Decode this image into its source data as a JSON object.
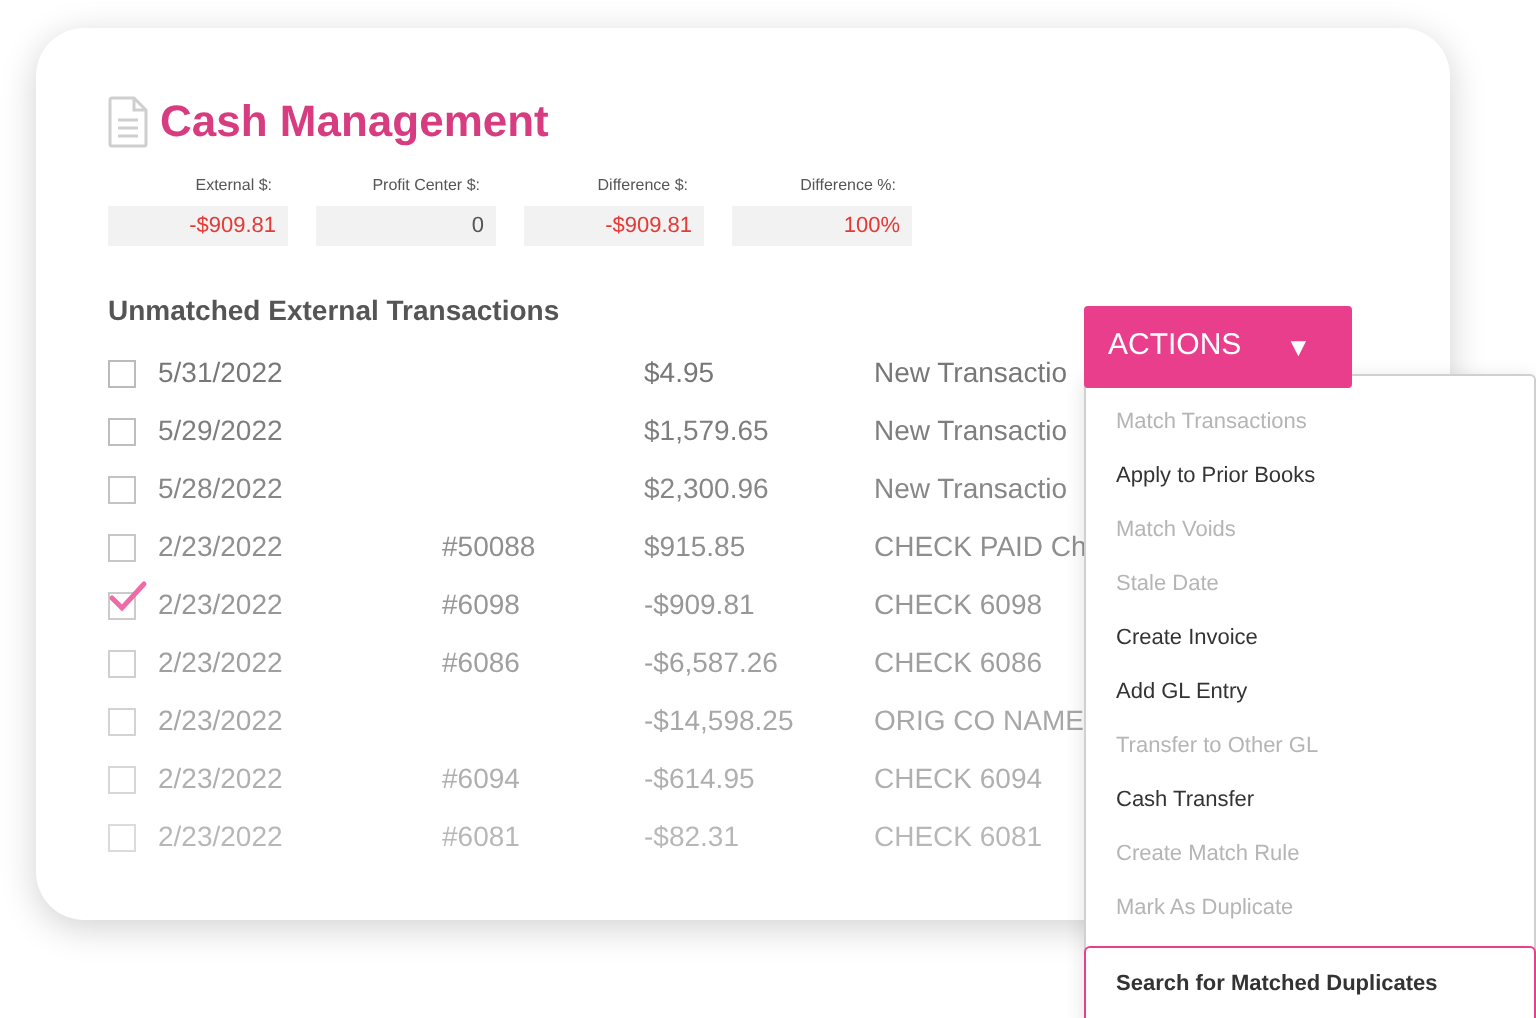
{
  "title": "Cash Management",
  "summary": [
    {
      "label": "External $:",
      "value": "-$909.81",
      "negative": true
    },
    {
      "label": "Profit Center $:",
      "value": "0",
      "negative": false
    },
    {
      "label": "Difference $:",
      "value": "-$909.81",
      "negative": true
    },
    {
      "label": "Difference %:",
      "value": "100%",
      "negative": true
    }
  ],
  "section_title": "Unmatched External Transactions",
  "transactions": [
    {
      "checked": false,
      "date": "5/31/2022",
      "amount": "$4.95",
      "description": "New Transactio"
    },
    {
      "checked": false,
      "date": "5/29/2022",
      "amount": "$1,579.65",
      "description": "New Transactio"
    },
    {
      "checked": false,
      "date": "5/28/2022",
      "amount": "$2,300.96",
      "description": "New Transactio"
    },
    {
      "checked": false,
      "date": "2/23/2022",
      "ref": "#50088",
      "amount": "$915.85",
      "description": "CHECK PAID Ch"
    },
    {
      "checked": true,
      "date": "2/23/2022",
      "ref": "#6098",
      "amount": "-$909.81",
      "description": "CHECK 6098"
    },
    {
      "checked": false,
      "date": "2/23/2022",
      "ref": "#6086",
      "amount": "-$6,587.26",
      "description": "CHECK 6086"
    },
    {
      "checked": false,
      "date": "2/23/2022",
      "amount": "-$14,598.25",
      "description": "ORIG CO NAME"
    },
    {
      "checked": false,
      "date": "2/23/2022",
      "ref": "#6094",
      "amount": "-$614.95",
      "description": "CHECK 6094"
    },
    {
      "checked": false,
      "date": "2/23/2022",
      "ref": "#6081",
      "amount": "-$82.31",
      "description": "CHECK 6081"
    }
  ],
  "actions": {
    "label": "ACTIONS",
    "caret": "▼",
    "expanded": true,
    "items": [
      {
        "label": "Match Transactions",
        "disabled": true,
        "selected": false
      },
      {
        "label": "Apply to Prior Books",
        "disabled": false,
        "selected": false
      },
      {
        "label": "Match Voids",
        "disabled": true,
        "selected": false
      },
      {
        "label": "Stale Date",
        "disabled": true,
        "selected": false
      },
      {
        "label": "Create Invoice",
        "disabled": false,
        "selected": false
      },
      {
        "label": "Add GL Entry",
        "disabled": false,
        "selected": false
      },
      {
        "label": "Transfer to Other GL",
        "disabled": true,
        "selected": false
      },
      {
        "label": "Cash Transfer",
        "disabled": false,
        "selected": false
      },
      {
        "label": "Create Match Rule",
        "disabled": true,
        "selected": false
      },
      {
        "label": "Mark As Duplicate",
        "disabled": true,
        "selected": false
      },
      {
        "label": "Search for Matched Duplicates",
        "disabled": false,
        "selected": true
      }
    ]
  }
}
